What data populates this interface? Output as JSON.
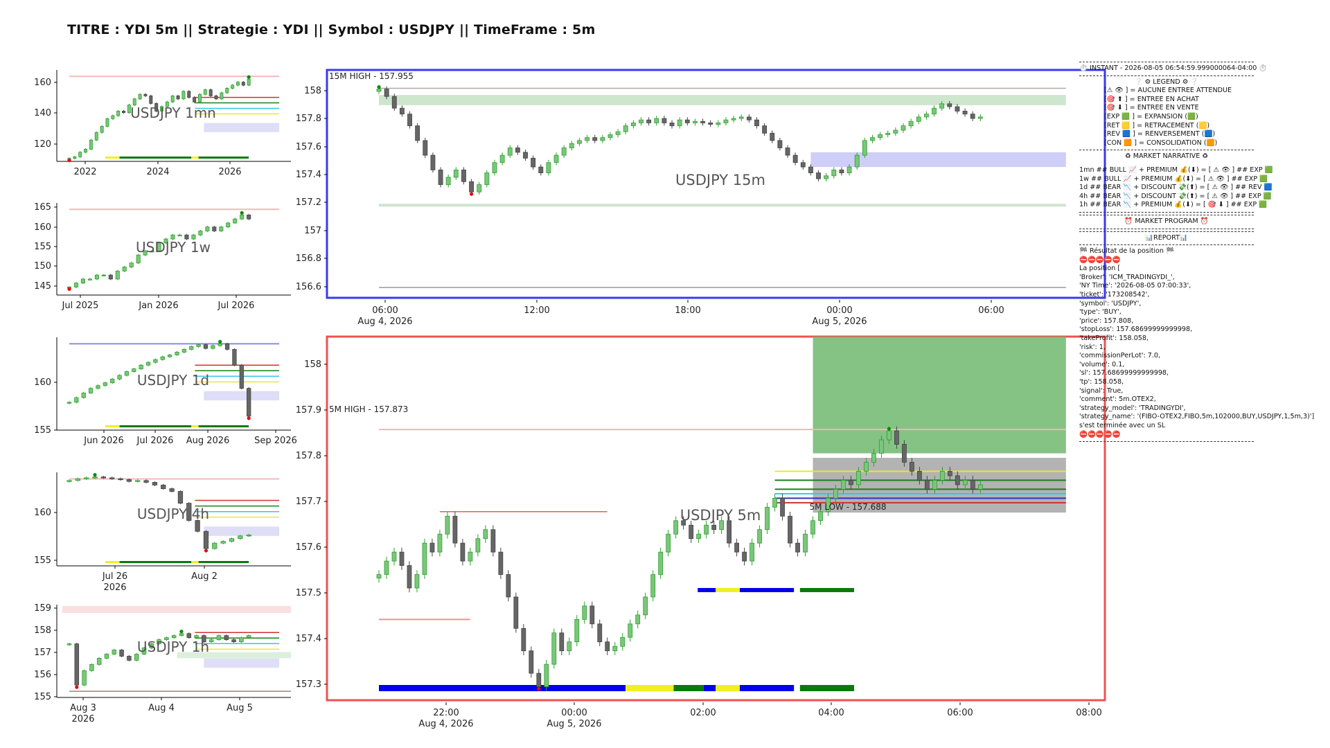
{
  "title": "TITRE : YDI 5m || Strategie : YDI || Symbol : USDJPY || TimeFrame : 5m",
  "colors": {
    "bull": "#2ca02c",
    "bear": "#444444",
    "frame_15m": "#3a3af0",
    "frame_5m": "#f05050",
    "zone_green": "#6fb86f",
    "zone_grey": "#9a9a9a"
  },
  "chart_data": [
    {
      "id": "p1mn",
      "type": "candlestick",
      "label": "USDJPY 1mn",
      "x_ticks": [
        "2022",
        "2024",
        "2026"
      ],
      "y_ticks": [
        "160",
        "140",
        "120"
      ],
      "ylim": [
        108,
        168
      ],
      "closes": [
        110,
        111,
        114,
        116,
        122,
        127,
        131,
        136,
        138,
        141,
        140,
        145,
        149,
        152,
        151,
        146,
        141,
        144,
        147,
        151,
        149,
        154,
        150,
        147,
        152,
        155,
        151,
        149,
        153,
        156,
        158,
        160,
        158,
        162
      ]
    },
    {
      "id": "p1w",
      "type": "candlestick",
      "label": "USDJPY 1w",
      "x_ticks": [
        "Jul 2025",
        "Jan 2026",
        "Jul 2026"
      ],
      "y_ticks": [
        "165",
        "160",
        "155",
        "150",
        "145"
      ],
      "ylim": [
        143,
        166
      ],
      "closes": [
        145,
        146,
        147,
        147,
        148,
        148,
        147,
        149,
        150,
        151,
        153,
        154,
        154,
        156,
        157,
        158,
        158,
        157,
        158,
        159,
        160,
        159,
        160,
        161,
        162,
        163,
        162
      ]
    },
    {
      "id": "p1d",
      "type": "candlestick",
      "label": "USDJPY 1d",
      "x_ticks": [
        "Jun 2026",
        "Jul 2026",
        "Aug 2026",
        "Sep 2026"
      ],
      "y_ticks": [
        "160",
        "155"
      ],
      "ylim": [
        154.5,
        164.5
      ],
      "closes": [
        157.5,
        158,
        158.5,
        159,
        159.3,
        159.6,
        160,
        160.4,
        160.8,
        161.1,
        161.5,
        161.8,
        162.1,
        162.4,
        162.6,
        162.9,
        163.2,
        163.5,
        163.7,
        163.3,
        163.6,
        163.8,
        163.2,
        161.5,
        159,
        156
      ]
    },
    {
      "id": "p4h",
      "type": "candlestick",
      "label": "USDJPY 4h",
      "x_ticks": [
        "Jul 26",
        "Aug 2"
      ],
      "x_subticks": [
        "2026",
        ""
      ],
      "y_ticks": [
        "160",
        "155"
      ],
      "ylim": [
        154.3,
        164.6
      ],
      "closes": [
        163.7,
        163.9,
        164,
        164.1,
        164,
        163.9,
        163.8,
        163.6,
        163.7,
        163.5,
        163.2,
        162.8,
        162.5,
        161.2,
        159.3,
        158.1,
        156.2,
        156.8,
        157,
        157.3,
        157.6,
        157.7
      ]
    },
    {
      "id": "p1h",
      "type": "candlestick",
      "label": "USDJPY 1h",
      "x_ticks": [
        "Aug 3",
        "Aug 4",
        "Aug 5"
      ],
      "x_subticks": [
        "2026",
        "",
        ""
      ],
      "y_ticks": [
        "159",
        "158",
        "157",
        "156",
        "155"
      ],
      "ylim": [
        154.9,
        159.4
      ],
      "closes": [
        157.5,
        155.5,
        156.2,
        156.5,
        156.8,
        157,
        157.2,
        156.9,
        156.7,
        157,
        157.3,
        157.5,
        157.7,
        157.8,
        157.9,
        158,
        157.8,
        157.9,
        157.6,
        157.7,
        157.9,
        157.7,
        157.6,
        157.8,
        157.9
      ]
    },
    {
      "id": "p15",
      "type": "candlestick",
      "label": "USDJPY 15m",
      "annotation": "15M HIGH - 157.955",
      "x_ticks": [
        "06:00",
        "12:00",
        "18:00",
        "00:00",
        "06:00"
      ],
      "x_subticks": [
        "Aug 4, 2026",
        "",
        "",
        "Aug 5, 2026",
        ""
      ],
      "y_ticks": [
        "158",
        "157.8",
        "157.6",
        "157.4",
        "157.2",
        "157",
        "156.8",
        "156.6"
      ],
      "ylim": [
        156.53,
        158.08
      ],
      "closes": [
        157.95,
        157.9,
        157.82,
        157.78,
        157.7,
        157.6,
        157.5,
        157.4,
        157.3,
        157.35,
        157.4,
        157.32,
        157.25,
        157.3,
        157.38,
        157.45,
        157.5,
        157.55,
        157.52,
        157.48,
        157.42,
        157.38,
        157.45,
        157.5,
        157.55,
        157.58,
        157.6,
        157.62,
        157.6,
        157.62,
        157.64,
        157.66,
        157.7,
        157.72,
        157.74,
        157.72,
        157.75,
        157.72,
        157.7,
        157.74,
        157.72,
        157.73,
        157.72,
        157.71,
        157.72,
        157.74,
        157.75,
        157.76,
        157.74,
        157.7,
        157.65,
        157.6,
        157.55,
        157.5,
        157.45,
        157.42,
        157.38,
        157.34,
        157.36,
        157.4,
        157.38,
        157.42,
        157.5,
        157.6,
        157.62,
        157.64,
        157.65,
        157.67,
        157.7,
        157.73,
        157.76,
        157.78,
        157.82,
        157.85,
        157.83,
        157.8,
        157.78,
        157.75,
        157.76
      ]
    },
    {
      "id": "p5",
      "type": "candlestick",
      "label": "USDJPY 5m",
      "annotation_high": "5M HIGH - 157.873",
      "annotation_low": "5M LOW - 157.688",
      "x_ticks": [
        "22:00",
        "00:00",
        "02:00",
        "04:00",
        "06:00",
        "08:00"
      ],
      "x_subticks": [
        "Aug 4, 2026",
        "Aug 5, 2026",
        "",
        "",
        "",
        ""
      ],
      "y_ticks": [
        "158",
        "157.9",
        "157.8",
        "157.7",
        "157.6",
        "157.5",
        "157.4",
        "157.3"
      ],
      "ylim": [
        157.27,
        158.08
      ],
      "closes": [
        157.55,
        157.58,
        157.6,
        157.57,
        157.52,
        157.55,
        157.62,
        157.6,
        157.64,
        157.68,
        157.62,
        157.58,
        157.6,
        157.63,
        157.65,
        157.6,
        157.55,
        157.5,
        157.43,
        157.38,
        157.33,
        157.3,
        157.35,
        157.42,
        157.38,
        157.4,
        157.45,
        157.48,
        157.44,
        157.4,
        157.38,
        157.39,
        157.41,
        157.44,
        157.46,
        157.5,
        157.55,
        157.6,
        157.64,
        157.67,
        157.66,
        157.63,
        157.64,
        157.66,
        157.65,
        157.67,
        157.62,
        157.6,
        157.58,
        157.62,
        157.65,
        157.7,
        157.72,
        157.68,
        157.62,
        157.6,
        157.64,
        157.67,
        157.69,
        157.72,
        157.74,
        157.76,
        157.75,
        157.78,
        157.8,
        157.82,
        157.85,
        157.87,
        157.84,
        157.8,
        157.78,
        157.76,
        157.74,
        157.76,
        157.78,
        157.77,
        157.75,
        157.76,
        157.74,
        157.75
      ]
    }
  ],
  "info": {
    "instant": "⏱️ INSTANT - 2026-08-05 06:54:59.999000064-04:00 ⏱️",
    "legend_title": "❔ ⚙ LEGEND ⚙ ❔",
    "legend": [
      "[⚠ 👁 ] = AUCUNE ENTREE ATTENDUE",
      "[🎯 ⬆ ] = ENTREE EN ACHAT",
      "[🎯 ⬇ ] = ENTREE EN VENTE",
      "[EXP 🟩 ] = EXPANSION (🟩)",
      "[RET 🟨 ] = RETRACEMENT (🟨)",
      "[REV 🟦 ] = RENVERSEMENT (🟦)",
      "[CON 🟧 ] = CONSOLIDATION (🟧)"
    ],
    "narrative_title": "♻ MARKET NARRATIVE ♻",
    "narrative": [
      "1mn ## BULL 📈 + PREMIUM 💰(⬇) = [ ⚠ 👁 ] ## EXP 🟩",
      "1w ## BULL 📈 + PREMIUM 💰(⬇) = [ ⚠ 👁 ] ## EXP 🟩",
      "1d ## BEAR 📉 + DISCOUNT 💸(⬆) = [ ⚠ 👁 ] ## REV 🟦",
      "4h ## BEAR 📉 + DISCOUNT 💸(⬆) = [ ⚠ 👁 ] ## EXP 🟩",
      "1h ## BEAR 📉 + PREMIUM 💰(⬇) = [ 🎯 ⬇ ] ## EXP 🟩"
    ],
    "program_title": "⏰ MARKET PROGRAM ⏰",
    "report_title": "📊REPORT📊",
    "result_title": "🏁 Résultat de la position 🏁",
    "stop_row": "⛔⛔⛔⛔⛔",
    "position": [
      "La position [",
      "'Broker': 'ICM_TRADINGYDI_',",
      "'NY Time': '2026-08-05 07:00:33',",
      "'ticket': '173208542',",
      "'symbol': 'USDJPY',",
      "'type': 'BUY',",
      "'price': 157.808,",
      "'stopLoss': 157.68699999999998,",
      "'takeProfit': 158.058,",
      "'risk': 1,",
      "'commissionPerLot': 7.0,",
      "'volume': 0.1,",
      "'sl': 157.68699999999998,",
      "'tp': 158.058,",
      "'signal': True,",
      "'comment': 5m.OTEX2,",
      "'strategy_model': 'TRADINGYDI',",
      "'strategy_name': '(FIBO-OTEX2,FIBO,5m,102000,BUY,USDJPY,1,5m,3)']",
      "s'est terminée avec un SL"
    ]
  }
}
